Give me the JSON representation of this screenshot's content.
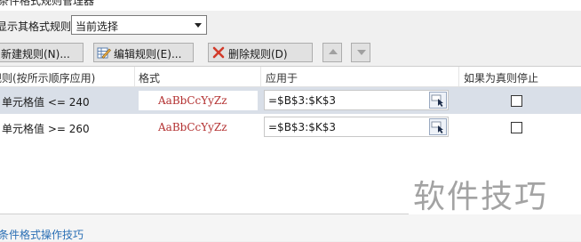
{
  "dialog": {
    "title": "条件格式规则管理器"
  },
  "show_rules": {
    "label": "显示其格式规则(S):",
    "value": "当前选择"
  },
  "toolbar": {
    "new_rule": "新建规则(N)...",
    "edit_rule": "编辑规则(E)...",
    "delete_rule": "删除规则(D)"
  },
  "table": {
    "headers": [
      "规则(按所示顺序应用)",
      "格式",
      "应用于",
      "如果为真则停止"
    ],
    "rows": [
      {
        "rule": "单元格值 <= 240",
        "preview": "AaBbCcYyZz",
        "applies_to": "=$B$3:$K$3",
        "stop_if_true": false
      },
      {
        "rule": "单元格值 >= 260",
        "preview": "AaBbCcYyZz",
        "applies_to": "=$B$3:$K$3",
        "stop_if_true": false
      }
    ]
  },
  "footer": {
    "link": "条件格式操作技巧"
  },
  "watermark": "软件技巧",
  "colors": {
    "preview_text": "#b33030",
    "selected_row": "#d9dfe8",
    "link": "#2a6fb5"
  }
}
